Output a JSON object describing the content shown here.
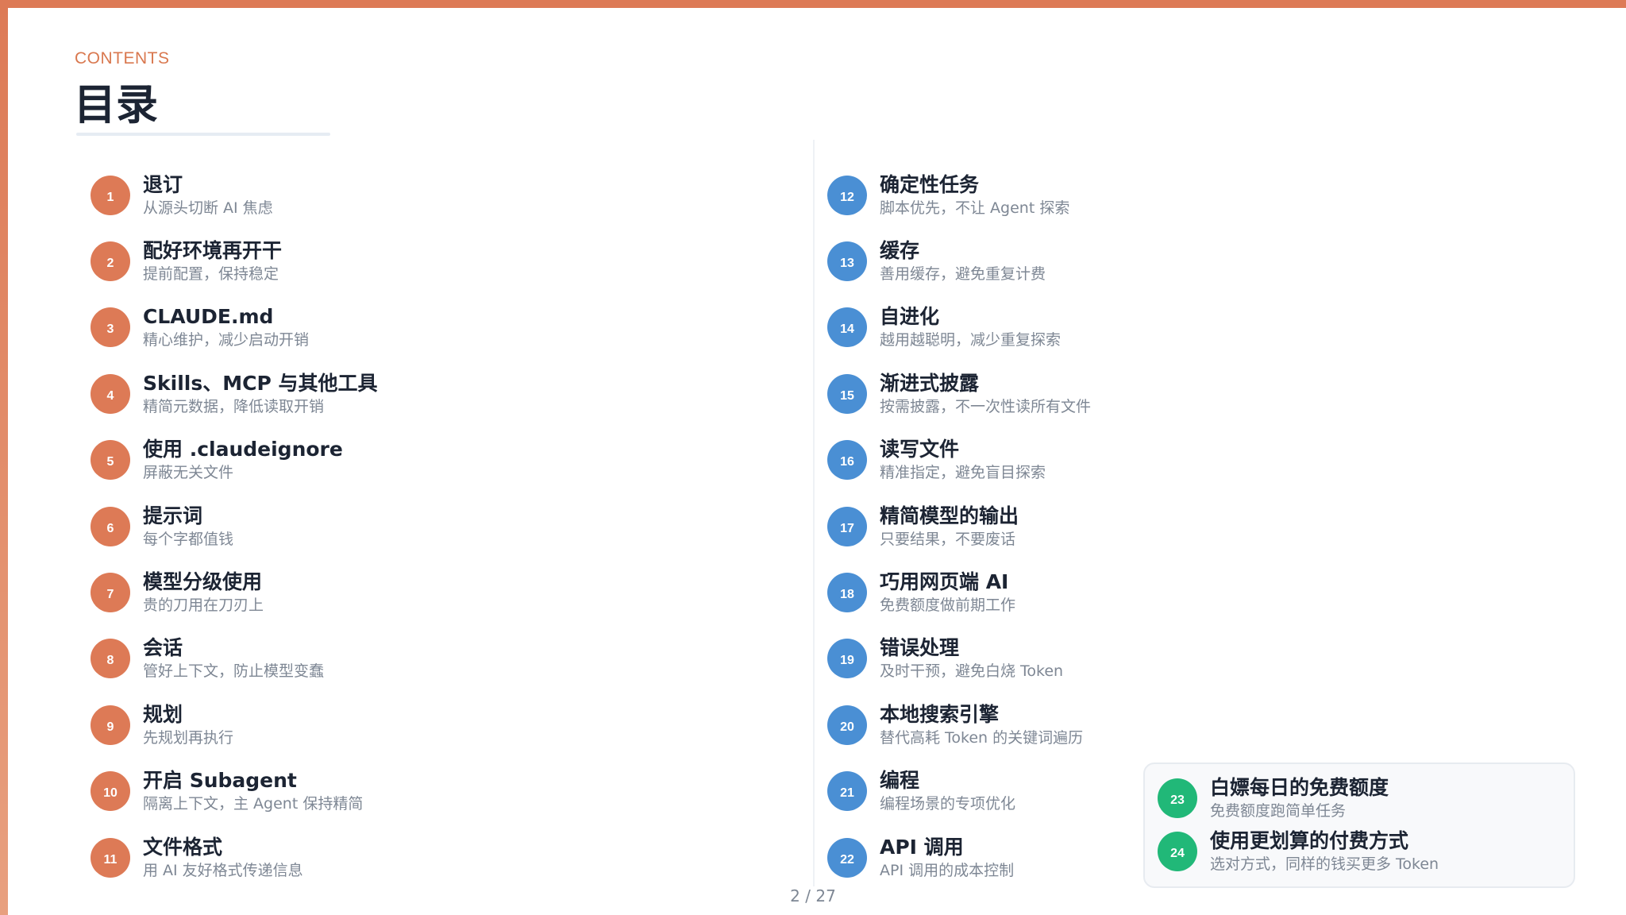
{
  "header": {
    "eyebrow": "CONTENTS",
    "title": "目录"
  },
  "left_items": [
    {
      "num": "1",
      "title": "退订",
      "subtitle": "从源头切断 AI 焦虑"
    },
    {
      "num": "2",
      "title": "配好环境再开干",
      "subtitle": "提前配置，保持稳定"
    },
    {
      "num": "3",
      "title": "CLAUDE.md",
      "subtitle": "精心维护，减少启动开销"
    },
    {
      "num": "4",
      "title": "Skills、MCP 与其他工具",
      "subtitle": "精简元数据，降低读取开销"
    },
    {
      "num": "5",
      "title": "使用 .claudeignore",
      "subtitle": "屏蔽无关文件"
    },
    {
      "num": "6",
      "title": "提示词",
      "subtitle": "每个字都值钱"
    },
    {
      "num": "7",
      "title": "模型分级使用",
      "subtitle": "贵的刀用在刀刃上"
    },
    {
      "num": "8",
      "title": "会话",
      "subtitle": "管好上下文，防止模型变蠢"
    },
    {
      "num": "9",
      "title": "规划",
      "subtitle": "先规划再执行"
    },
    {
      "num": "10",
      "title": "开启 Subagent",
      "subtitle": "隔离上下文，主 Agent 保持精简"
    },
    {
      "num": "11",
      "title": "文件格式",
      "subtitle": "用 AI 友好格式传递信息"
    }
  ],
  "right_items": [
    {
      "num": "12",
      "title": "确定性任务",
      "subtitle": "脚本优先，不让 Agent 探索"
    },
    {
      "num": "13",
      "title": "缓存",
      "subtitle": "善用缓存，避免重复计费"
    },
    {
      "num": "14",
      "title": "自进化",
      "subtitle": "越用越聪明，减少重复探索"
    },
    {
      "num": "15",
      "title": "渐进式披露",
      "subtitle": "按需披露，不一次性读所有文件"
    },
    {
      "num": "16",
      "title": "读写文件",
      "subtitle": "精准指定，避免盲目探索"
    },
    {
      "num": "17",
      "title": "精简模型的输出",
      "subtitle": "只要结果，不要废话"
    },
    {
      "num": "18",
      "title": "巧用网页端 AI",
      "subtitle": "免费额度做前期工作"
    },
    {
      "num": "19",
      "title": "错误处理",
      "subtitle": "及时干预，避免白烧 Token"
    },
    {
      "num": "20",
      "title": "本地搜索引擎",
      "subtitle": "替代高耗 Token 的关键词遍历"
    },
    {
      "num": "21",
      "title": "编程",
      "subtitle": "编程场景的专项优化"
    },
    {
      "num": "22",
      "title": "API 调用",
      "subtitle": "API 调用的成本控制"
    }
  ],
  "highlight_items": [
    {
      "num": "23",
      "title": "白嫖每日的免费额度",
      "subtitle": "免费额度跑简单任务"
    },
    {
      "num": "24",
      "title": "使用更划算的付费方式",
      "subtitle": "选对方式，同样的钱买更多 Token"
    }
  ],
  "footer": {
    "page_indicator": "2 / 27"
  },
  "colors": {
    "accent_orange": "#dd7a56",
    "accent_blue": "#4a8fd4",
    "accent_green": "#21b878"
  }
}
